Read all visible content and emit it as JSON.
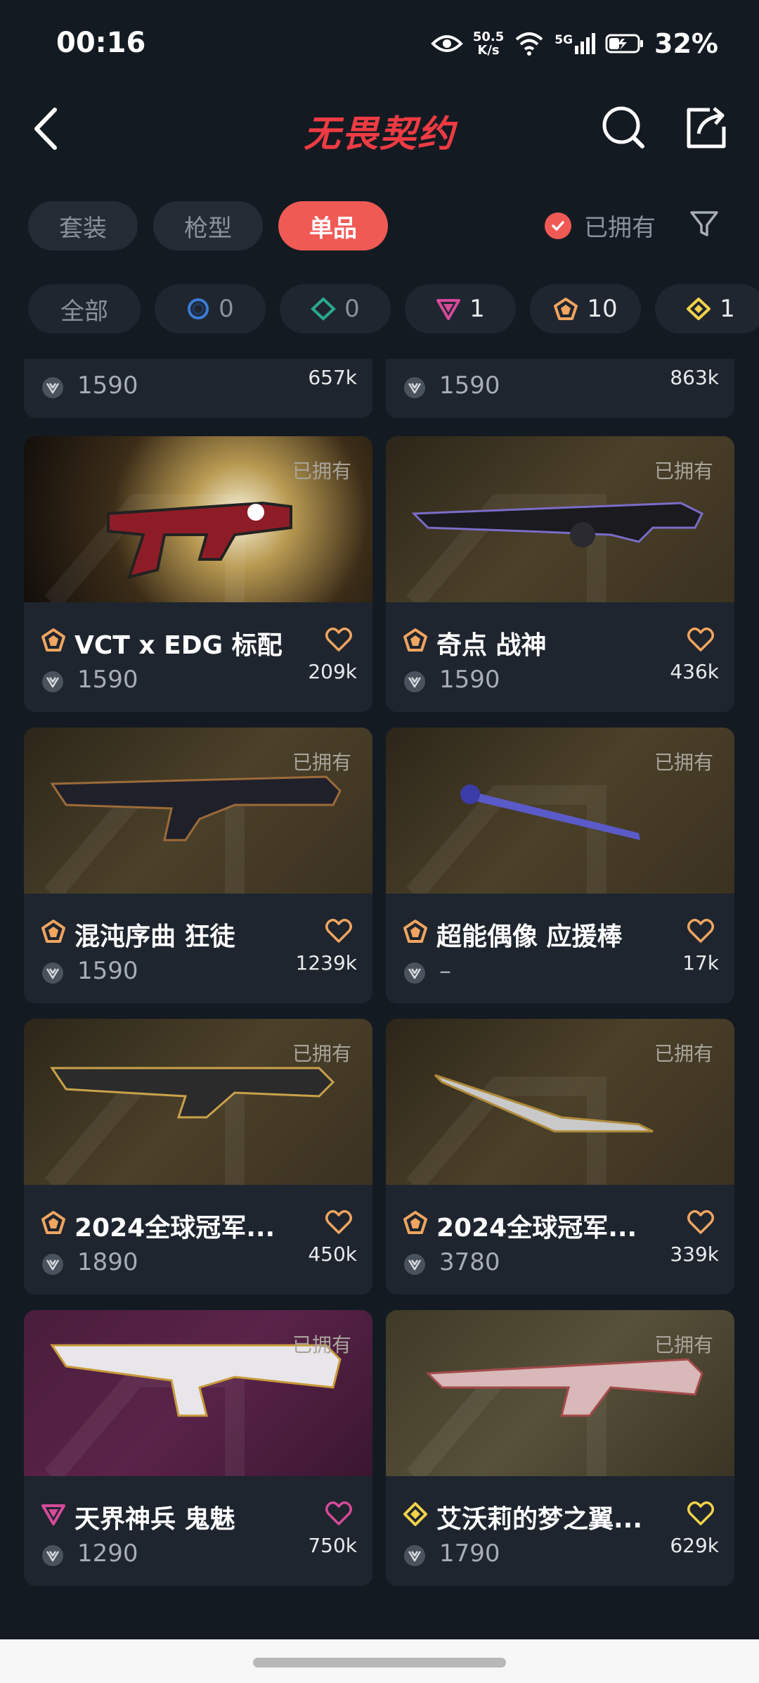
{
  "status_bar": {
    "time": "00:16",
    "net_speed_value": "50.5",
    "net_speed_unit": "K/s",
    "network": "5G",
    "battery_percent": "32%"
  },
  "header": {
    "title": "无畏契约"
  },
  "tabs": [
    {
      "label": "套装",
      "active": false
    },
    {
      "label": "枪型",
      "active": false
    },
    {
      "label": "单品",
      "active": true
    }
  ],
  "owned_filter": {
    "label": "已拥有",
    "checked": true
  },
  "rarity_chips": [
    {
      "label": "全部"
    },
    {
      "count": "0",
      "icon": "select-tier-icon",
      "color": "#3a7bd5"
    },
    {
      "count": "0",
      "icon": "deluxe-tier-icon",
      "color": "#2aa88f"
    },
    {
      "count": "1",
      "icon": "premium-tier-icon",
      "color": "#d64a9a"
    },
    {
      "count": "10",
      "icon": "exclusive-tier-icon",
      "color": "#f0a560"
    },
    {
      "count": "1",
      "icon": "ultra-tier-icon",
      "color": "#f2d24a"
    }
  ],
  "partial_cards": [
    {
      "price": "1590",
      "likes": "657k"
    },
    {
      "price": "1590",
      "likes": "863k"
    }
  ],
  "cards": [
    {
      "name": "VCT x EDG 标配",
      "price": "1590",
      "likes": "209k",
      "owned_label": "已拥有",
      "tier": "exclusive",
      "tier_color": "#f0a560",
      "heart_color": "#f0a560",
      "bg": "edg"
    },
    {
      "name": "奇点 战神",
      "price": "1590",
      "likes": "436k",
      "owned_label": "已拥有",
      "tier": "exclusive",
      "tier_color": "#f0a560",
      "heart_color": "#f0a560",
      "bg": "gold"
    },
    {
      "name": "混沌序曲 狂徒",
      "price": "1590",
      "likes": "1239k",
      "owned_label": "已拥有",
      "tier": "exclusive",
      "tier_color": "#f0a560",
      "heart_color": "#f0a560",
      "bg": "gold"
    },
    {
      "name": "超能偶像 应援棒",
      "price": "–",
      "likes": "17k",
      "owned_label": "已拥有",
      "tier": "exclusive",
      "tier_color": "#f0a560",
      "heart_color": "#f0a560",
      "bg": "gold"
    },
    {
      "name": "2024全球冠军...",
      "price": "1890",
      "likes": "450k",
      "owned_label": "已拥有",
      "tier": "exclusive",
      "tier_color": "#f0a560",
      "heart_color": "#f0a560",
      "bg": "gold"
    },
    {
      "name": "2024全球冠军...",
      "price": "3780",
      "likes": "339k",
      "owned_label": "已拥有",
      "tier": "exclusive",
      "tier_color": "#f0a560",
      "heart_color": "#f0a560",
      "bg": "gold"
    },
    {
      "name": "天界神兵 鬼魅",
      "price": "1290",
      "likes": "750k",
      "owned_label": "已拥有",
      "tier": "premium",
      "tier_color": "#d64a9a",
      "heart_color": "#d64a9a",
      "bg": "purple"
    },
    {
      "name": "艾沃莉的梦之翼...",
      "price": "1790",
      "likes": "629k",
      "owned_label": "已拥有",
      "tier": "ultra",
      "tier_color": "#f2d24a",
      "heart_color": "#f2d24a",
      "bg": "olive"
    }
  ]
}
